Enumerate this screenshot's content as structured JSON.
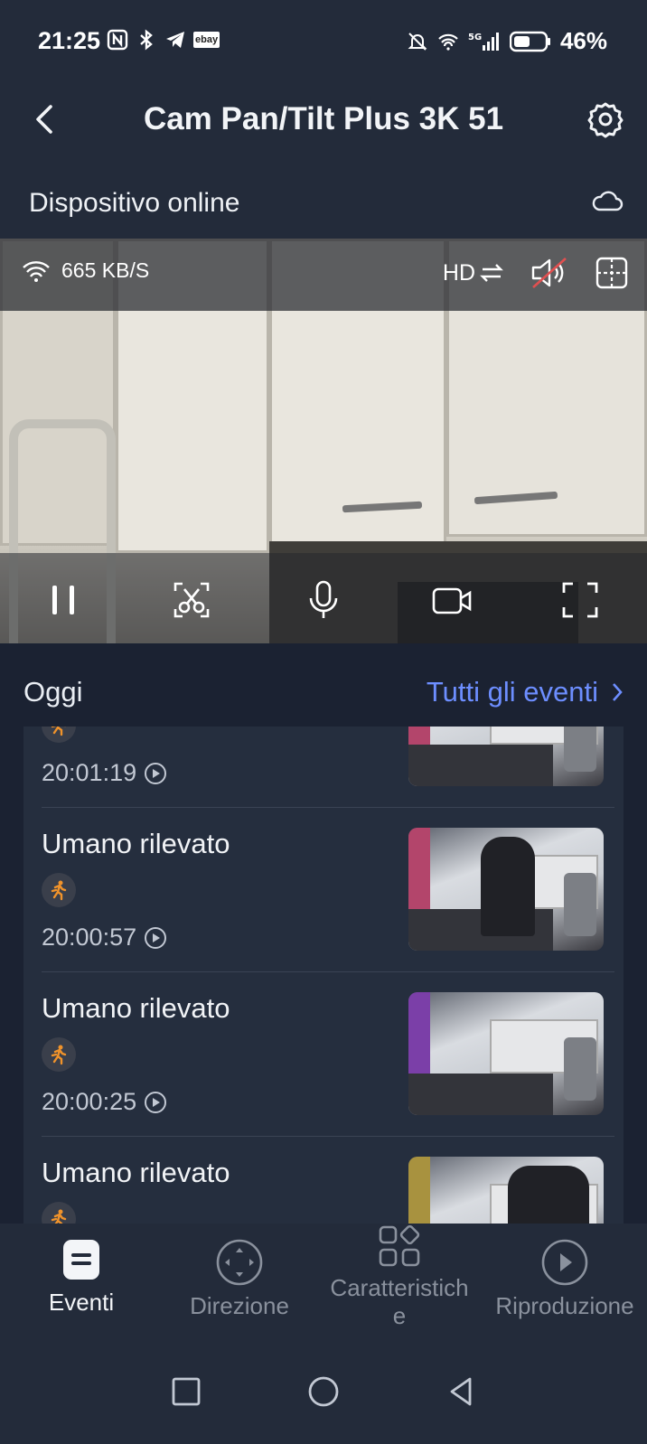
{
  "status_bar": {
    "time": "21:25",
    "left_icons": [
      "nfc-icon",
      "bluetooth-icon",
      "telegram-icon",
      "ebay-icon"
    ],
    "ebay_label": "ebay",
    "right_icons": [
      "mute-icon",
      "wifi-icon",
      "signal-5g-icon",
      "battery-icon"
    ],
    "battery_percent": "46%"
  },
  "header": {
    "title": "Cam Pan/Tilt Plus 3K 51"
  },
  "device_status": {
    "text": "Dispositivo online"
  },
  "video": {
    "bitrate": "665 KB/S",
    "quality_label": "HD",
    "controls": [
      "pause",
      "screenshot",
      "talk",
      "record",
      "fullscreen"
    ]
  },
  "events": {
    "section_title": "Oggi",
    "all_events_label": "Tutti gli eventi",
    "items": [
      {
        "title": "",
        "time": "20:01:19"
      },
      {
        "title": "Umano rilevato",
        "time": "20:00:57"
      },
      {
        "title": "Umano rilevato",
        "time": "20:00:25"
      },
      {
        "title": "Umano rilevato",
        "time": ""
      }
    ]
  },
  "bottom_nav": {
    "items": [
      {
        "label": "Eventi",
        "active": true
      },
      {
        "label": "Direzione",
        "active": false
      },
      {
        "label": "Caratteristich\ne",
        "active": false
      },
      {
        "label": "Riproduzione",
        "active": false
      }
    ]
  },
  "colors": {
    "accent": "#6d8eff",
    "background": "#1b2232",
    "header_bg": "#232b3a",
    "human_icon": "#f0932b"
  }
}
